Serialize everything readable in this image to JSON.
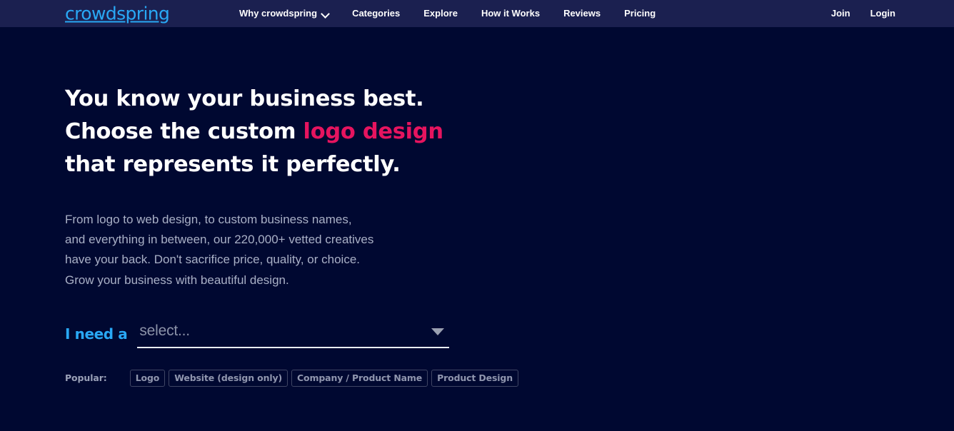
{
  "brand": {
    "logo_text": "crowdspring",
    "logo_color": "#29a8f5",
    "accent_pink": "#e6145f",
    "header_bg": "#1b2050",
    "page_bg": "#000831"
  },
  "nav": {
    "items": [
      {
        "label": "Why crowdspring",
        "has_dropdown": true
      },
      {
        "label": "Categories",
        "has_dropdown": false
      },
      {
        "label": "Explore",
        "has_dropdown": false
      },
      {
        "label": "How it Works",
        "has_dropdown": false
      },
      {
        "label": "Reviews",
        "has_dropdown": false
      },
      {
        "label": "Pricing",
        "has_dropdown": false
      }
    ],
    "account": [
      {
        "label": "Join"
      },
      {
        "label": "Login"
      }
    ],
    "dropdown_icon": "chevron-down-icon"
  },
  "hero": {
    "headline": {
      "line1": "You know your business best.",
      "line2_prefix": "Choose the custom ",
      "line2_accent": "logo design",
      "line3": "that represents it perfectly."
    },
    "subcopy": {
      "line1": "From logo to web design, to custom business names,",
      "line2": "and everything in between, our 220,000+ vetted creatives",
      "line3": "have your back. Don't sacrifice price, quality, or choice.",
      "line4": "Grow your business with beautiful design."
    },
    "selector": {
      "label": "I need a",
      "placeholder": "select...",
      "value": "",
      "caret_icon": "triangle-down-icon"
    },
    "popular": {
      "label": "Popular:",
      "tags": [
        {
          "label": "Logo"
        },
        {
          "label": "Website (design only)"
        },
        {
          "label": "Company / Product Name"
        },
        {
          "label": "Product Design"
        }
      ]
    }
  }
}
